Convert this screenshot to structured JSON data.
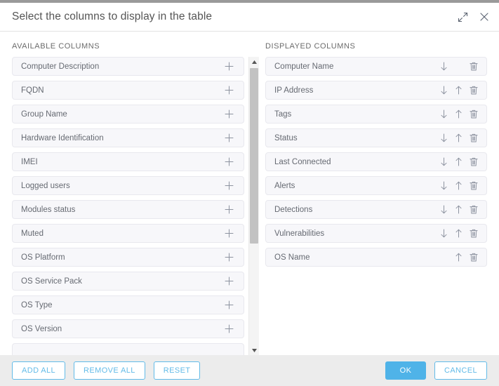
{
  "dialog": {
    "title": "Select the columns to display in the table",
    "expand_icon": "expand-diagonal-icon",
    "close_icon": "close-icon"
  },
  "available": {
    "heading": "AVAILABLE COLUMNS",
    "add_icon": "plus-icon",
    "items": [
      {
        "label": "Computer Description"
      },
      {
        "label": "FQDN"
      },
      {
        "label": "Group Name"
      },
      {
        "label": "Hardware Identification"
      },
      {
        "label": "IMEI"
      },
      {
        "label": "Logged users"
      },
      {
        "label": "Modules status"
      },
      {
        "label": "Muted"
      },
      {
        "label": "OS Platform"
      },
      {
        "label": "OS Service Pack"
      },
      {
        "label": "OS Type"
      },
      {
        "label": "OS Version"
      },
      {
        "label": ""
      }
    ]
  },
  "displayed": {
    "heading": "DISPLAYED COLUMNS",
    "move_down_icon": "arrow-down-icon",
    "move_up_icon": "arrow-up-icon",
    "remove_icon": "trash-icon",
    "items": [
      {
        "label": "Computer Name",
        "can_move_down": true,
        "can_move_up": false
      },
      {
        "label": "IP Address",
        "can_move_down": true,
        "can_move_up": true
      },
      {
        "label": "Tags",
        "can_move_down": true,
        "can_move_up": true
      },
      {
        "label": "Status",
        "can_move_down": true,
        "can_move_up": true
      },
      {
        "label": "Last Connected",
        "can_move_down": true,
        "can_move_up": true
      },
      {
        "label": "Alerts",
        "can_move_down": true,
        "can_move_up": true
      },
      {
        "label": "Detections",
        "can_move_down": true,
        "can_move_up": true
      },
      {
        "label": "Vulnerabilities",
        "can_move_down": true,
        "can_move_up": true
      },
      {
        "label": "OS Name",
        "can_move_down": false,
        "can_move_up": true
      }
    ]
  },
  "footer": {
    "add_all": "ADD ALL",
    "remove_all": "REMOVE ALL",
    "reset": "RESET",
    "ok": "OK",
    "cancel": "CANCEL"
  },
  "colors": {
    "primary": "#4fb3e8",
    "outline": "#62bbe8",
    "row_bg": "#f7f7fa",
    "footer_bg": "#ececec",
    "title_text": "#555555"
  }
}
